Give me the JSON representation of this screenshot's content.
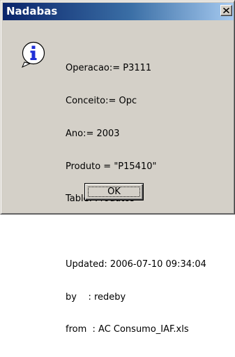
{
  "window": {
    "title": "Nadabas",
    "close_icon": "close-icon"
  },
  "message": {
    "icon": "info-icon",
    "lines": [
      "Operacao:= P3111",
      "Conceito:= Opc",
      "Ano:= 2003",
      "Produto = \"P15410\"",
      "Table: Produtos",
      "Updated: 2006-07-10 09:34:04",
      "by    : redeby",
      "from  : AC Consumo_IAF.xls"
    ]
  },
  "buttons": {
    "ok_label": "OK"
  },
  "colors": {
    "title_bar_start": "#0a246a",
    "title_bar_end": "#a6caf0",
    "dialog_face": "#d4d0c8",
    "icon_blue": "#1f2fd6"
  }
}
